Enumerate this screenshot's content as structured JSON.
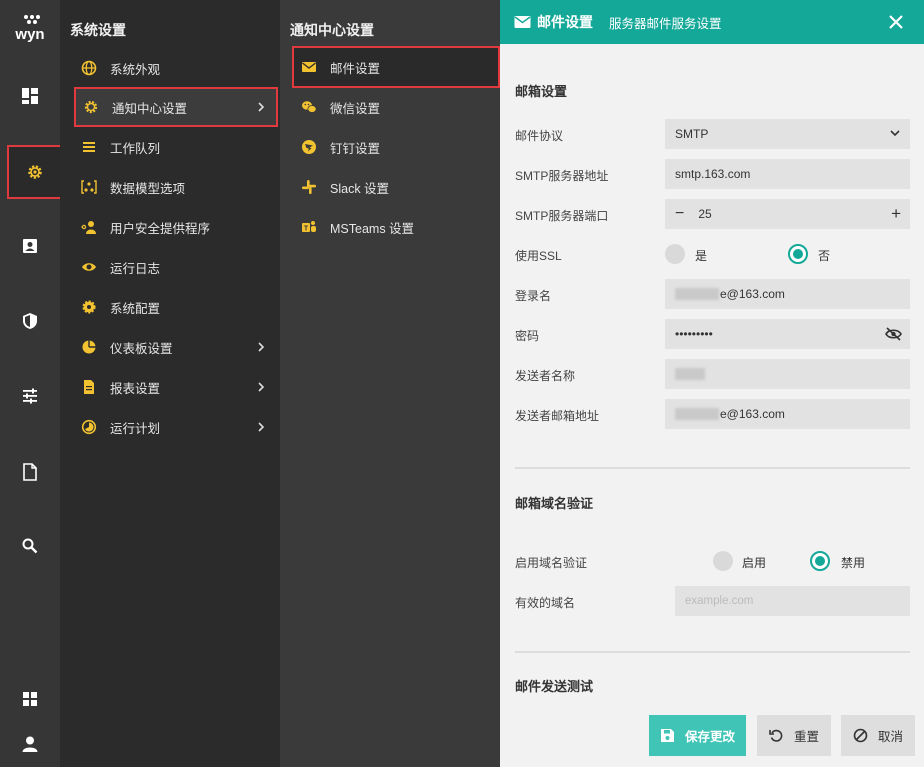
{
  "app": {
    "logo_text": "wyn"
  },
  "accent_color": "#14a898",
  "highlight_color": "#e0393e",
  "rail": {
    "items": [
      {
        "icon": "dashboard-icon"
      },
      {
        "icon": "gear-icon",
        "active": true
      },
      {
        "icon": "contact-card-icon"
      },
      {
        "icon": "shield-icon"
      },
      {
        "icon": "sliders-icon"
      },
      {
        "icon": "document-icon"
      },
      {
        "icon": "search-icon"
      },
      {
        "icon": "grid-icon"
      },
      {
        "icon": "user-icon"
      }
    ]
  },
  "system_settings": {
    "title": "系统设置",
    "items": [
      {
        "label": "系统外观",
        "icon": "globe-icon"
      },
      {
        "label": "通知中心设置",
        "icon": "gear-icon",
        "selected": true,
        "has_submenu": true
      },
      {
        "label": "工作队列",
        "icon": "list-icon"
      },
      {
        "label": "数据模型选项",
        "icon": "model-icon"
      },
      {
        "label": "用户安全提供程序",
        "icon": "key-user-icon"
      },
      {
        "label": "运行日志",
        "icon": "eye-icon"
      },
      {
        "label": "系统配置",
        "icon": "gear-icon"
      },
      {
        "label": "仪表板设置",
        "icon": "pie-icon",
        "has_submenu": true
      },
      {
        "label": "报表设置",
        "icon": "report-icon",
        "has_submenu": true
      },
      {
        "label": "运行计划",
        "icon": "clock-icon",
        "has_submenu": true
      }
    ]
  },
  "notification_center": {
    "title": "通知中心设置",
    "items": [
      {
        "label": "邮件设置",
        "icon": "mail-icon",
        "selected": true
      },
      {
        "label": "微信设置",
        "icon": "wechat-icon"
      },
      {
        "label": "钉钉设置",
        "icon": "dingtalk-icon"
      },
      {
        "label": "Slack 设置",
        "icon": "slack-icon"
      },
      {
        "label": "MSTeams 设置",
        "icon": "teams-icon"
      }
    ]
  },
  "panel": {
    "title": "邮件设置",
    "subtitle": "服务器邮件服务设置",
    "mailbox_section": {
      "title": "邮箱设置",
      "protocol_label": "邮件协议",
      "protocol_value": "SMTP",
      "server_label": "SMTP服务器地址",
      "server_value": "smtp.163.com",
      "port_label": "SMTP服务器端口",
      "port_value": "25",
      "ssl_label": "使用SSL",
      "ssl_yes": "是",
      "ssl_no": "否",
      "ssl_enabled": false,
      "login_label": "登录名",
      "login_value_suffix": "e@163.com",
      "password_label": "密码",
      "password_value": "•••••••••",
      "sender_name_label": "发送者名称",
      "sender_email_label": "发送者邮箱地址",
      "sender_email_suffix": "e@163.com"
    },
    "domain_section": {
      "title": "邮箱域名验证",
      "enable_label": "启用域名验证",
      "enable_on": "启用",
      "enable_off": "禁用",
      "enabled": false,
      "valid_domain_label": "有效的域名",
      "valid_domain_placeholder": "example.com"
    },
    "test_section": {
      "title": "邮件发送测试"
    },
    "buttons": {
      "save": "保存更改",
      "reset": "重置",
      "cancel": "取消"
    }
  }
}
